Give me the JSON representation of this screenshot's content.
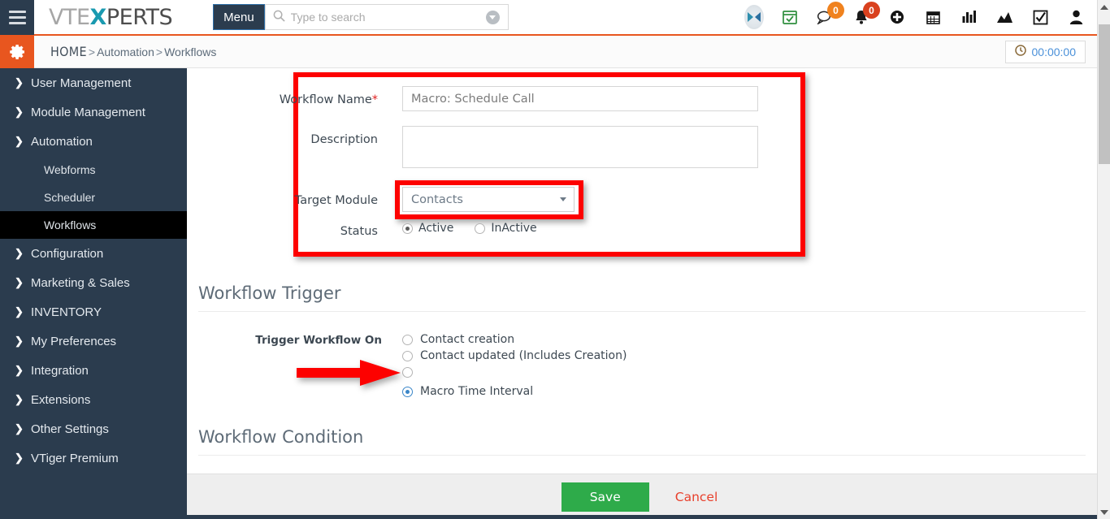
{
  "header": {
    "hamburger_icon": "hamburger-menu-icon",
    "logo": {
      "part1": "VTE",
      "accent": "X",
      "part2": "PERTS"
    },
    "menu_label": "Menu",
    "search_placeholder": "Type to search",
    "search_value": "",
    "search_icon": "search-icon",
    "search_caret_icon": "chevron-down-circle-icon",
    "icons": [
      {
        "name": "xperts-logo-icon",
        "label": "X"
      },
      {
        "name": "calendar-check-icon",
        "label": ""
      },
      {
        "name": "chat-bubble-icon",
        "badge": "0",
        "badge_color": "#f0821e"
      },
      {
        "name": "bell-icon",
        "badge": "0",
        "badge_color": "#d9411e"
      },
      {
        "name": "plus-circle-icon",
        "label": ""
      },
      {
        "name": "calendar-icon",
        "label": ""
      },
      {
        "name": "bar-chart-icon",
        "label": ""
      },
      {
        "name": "area-chart-icon",
        "label": ""
      },
      {
        "name": "checkbox-icon",
        "label": ""
      },
      {
        "name": "user-icon",
        "label": ""
      }
    ]
  },
  "breadcrumb": {
    "gear_icon": "gear-icon",
    "home": "HOME",
    "sep1": ">",
    "item1": "Automation",
    "sep2": ">",
    "item2": "Workflows",
    "timer_icon": "clock-icon",
    "timer_value": "00:00:00"
  },
  "sidebar": {
    "items": [
      {
        "label": "User Management",
        "icon": "chevron-right-icon",
        "type": "group",
        "expanded": false
      },
      {
        "label": "Module Management",
        "icon": "chevron-right-icon",
        "type": "group",
        "expanded": false
      },
      {
        "label": "Automation",
        "icon": "chevron-down-icon",
        "type": "group",
        "expanded": true
      },
      {
        "label": "Webforms",
        "type": "sub",
        "active": false
      },
      {
        "label": "Scheduler",
        "type": "sub",
        "active": false
      },
      {
        "label": "Workflows",
        "type": "sub",
        "active": true
      },
      {
        "label": "Configuration",
        "icon": "chevron-right-icon",
        "type": "group",
        "expanded": false
      },
      {
        "label": "Marketing & Sales",
        "icon": "chevron-right-icon",
        "type": "group",
        "expanded": false
      },
      {
        "label": "INVENTORY",
        "icon": "chevron-right-icon",
        "type": "group",
        "expanded": false
      },
      {
        "label": "My Preferences",
        "icon": "chevron-right-icon",
        "type": "group",
        "expanded": false
      },
      {
        "label": "Integration",
        "icon": "chevron-right-icon",
        "type": "group",
        "expanded": false
      },
      {
        "label": "Extensions",
        "icon": "chevron-right-icon",
        "type": "group",
        "expanded": false
      },
      {
        "label": "Other Settings",
        "icon": "chevron-right-icon",
        "type": "group",
        "expanded": false
      },
      {
        "label": "VTiger Premium",
        "icon": "chevron-right-icon",
        "type": "group",
        "expanded": false
      }
    ]
  },
  "form": {
    "workflow_name_label": "Workflow Name",
    "workflow_name_required": "*",
    "workflow_name_value": "Macro: Schedule Call",
    "description_label": "Description",
    "description_value": "",
    "target_module_label": "Target Module",
    "target_module_value": "Contacts",
    "target_module_options": [
      "Contacts"
    ],
    "status_label": "Status",
    "status_options": [
      {
        "label": "Active",
        "checked": true
      },
      {
        "label": "InActive",
        "checked": false
      }
    ]
  },
  "trigger_section": {
    "heading": "Workflow Trigger",
    "field_label": "Trigger Workflow On",
    "options": [
      {
        "label": "Contact creation",
        "checked": false
      },
      {
        "label": "Contact updated  (Includes Creation)",
        "checked": false
      },
      {
        "label": "",
        "checked": false
      },
      {
        "label": "Macro Time Interval",
        "checked": true
      }
    ]
  },
  "condition_section": {
    "heading": "Workflow Condition"
  },
  "footer": {
    "save_label": "Save",
    "cancel_label": "Cancel"
  },
  "annotations": {
    "arrow_color": "#fd0100",
    "highlight_color": "#fd0100"
  },
  "colors": {
    "sidebar_bg": "#2b3c4e",
    "accent_orange": "#e8561f",
    "save_green": "#2eab4a",
    "cancel_red": "#e8402c",
    "logo_accent": "#1a9ab0"
  }
}
